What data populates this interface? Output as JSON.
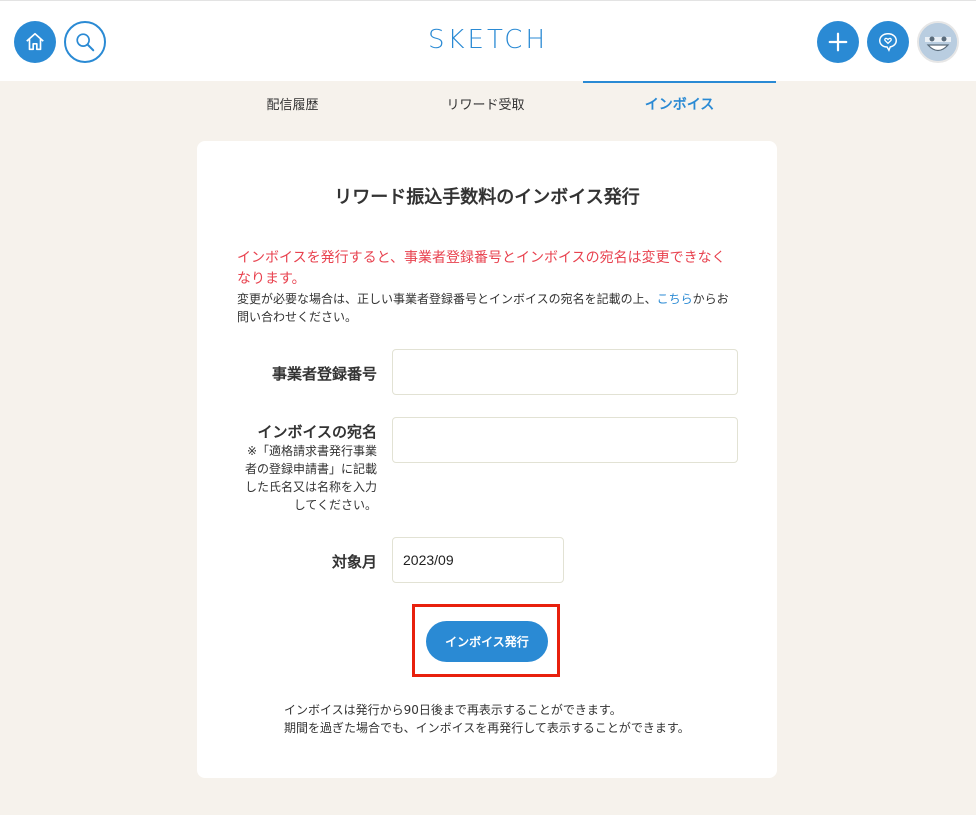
{
  "header": {
    "logo": "SKETCH",
    "icons": {
      "home": "home-icon",
      "search": "search-icon",
      "add": "plus-icon",
      "message": "heart-speech-bubble-icon",
      "avatar": "avatar"
    }
  },
  "tabs": [
    {
      "label": "配信履歴",
      "active": false
    },
    {
      "label": "リワード受取",
      "active": false
    },
    {
      "label": "インボイス",
      "active": true
    }
  ],
  "card": {
    "title": "リワード振込手数料のインボイス発行",
    "warning_line1": "インボイスを発行すると、事業者登録番号とインボイスの宛名は変更できなく",
    "warning_line2": "なります。",
    "note_before_link": "変更が必要な場合は、正しい事業者登録番号とインボイスの宛名を記載の上、",
    "note_link": "こちら",
    "note_after_link_line1": "からお",
    "note_line2": "問い合わせください。",
    "form": {
      "registration_label": "事業者登録番号",
      "registration_value": "",
      "addressee_label": "インボイスの宛名",
      "addressee_sub_line1": "※「適格請求書発行事業",
      "addressee_sub_line2": "者の登録申請書」に記載",
      "addressee_sub_line3": "した氏名又は名称を入力",
      "addressee_sub_line4": "してください。",
      "addressee_value": "",
      "month_label": "対象月",
      "month_value": "2023/09"
    },
    "issue_button": "インボイス発行",
    "footer_line1": "インボイスは発行から90日後まで再表示することができます。",
    "footer_line2": "期間を過ぎた場合でも、インボイスを再発行して表示することができます。"
  },
  "colors": {
    "accent": "#2a8ad4",
    "warning": "#e8424f",
    "highlight": "#e8200d",
    "background": "#f6f2ec"
  }
}
